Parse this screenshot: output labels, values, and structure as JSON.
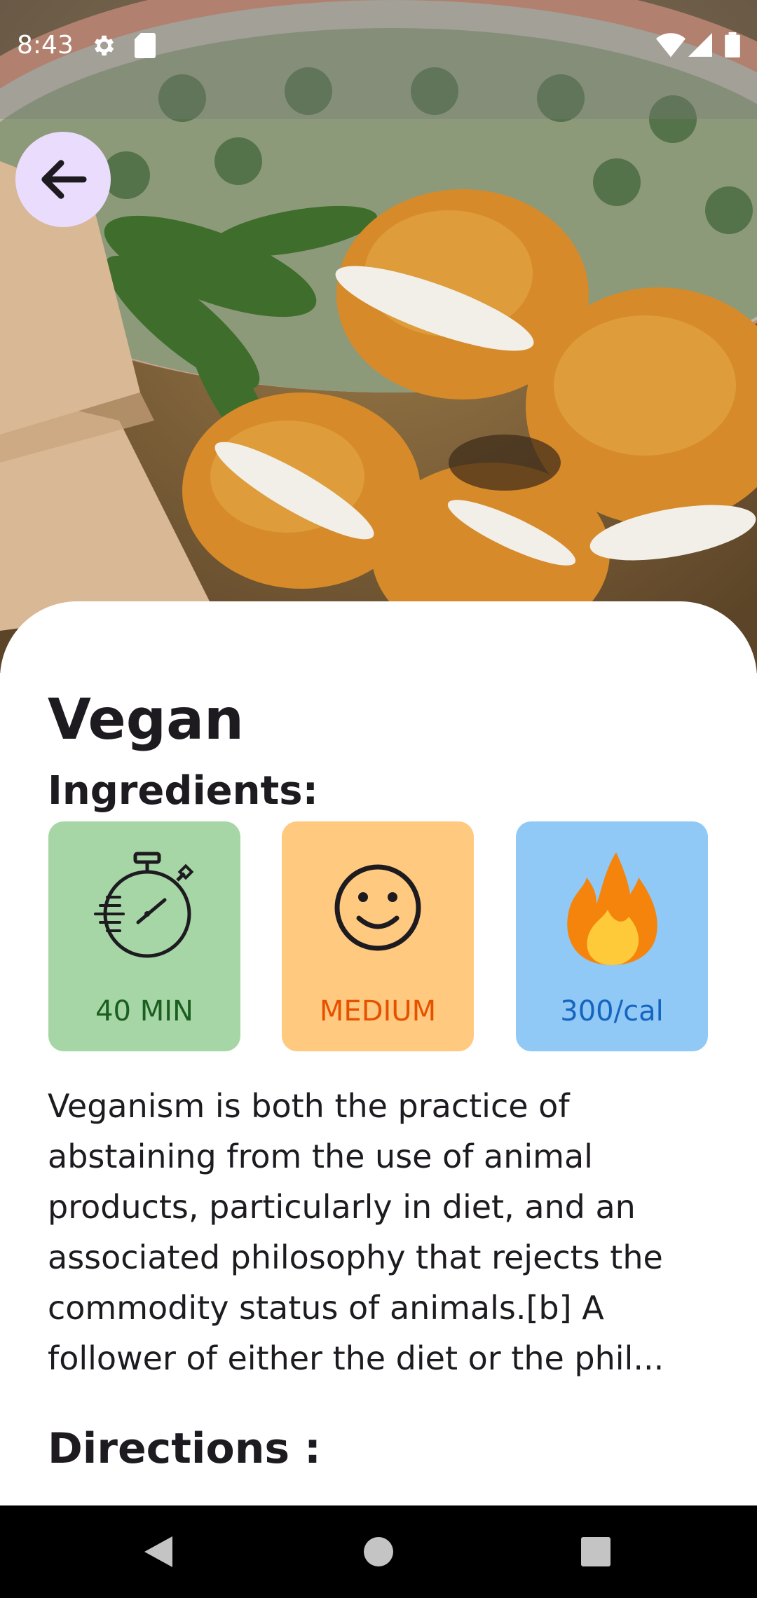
{
  "status_bar": {
    "time": "8:43",
    "icons": [
      "settings-icon",
      "sd-card-icon",
      "wifi-icon",
      "signal-icon",
      "battery-icon"
    ]
  },
  "hero": {
    "image": "food-photo-vegan-falafel-bowl"
  },
  "back_button": {
    "icon": "arrow-back-icon"
  },
  "recipe": {
    "title": "Vegan",
    "ingredients_heading": "Ingredients:",
    "stats": [
      {
        "icon": "stopwatch-icon",
        "label": "40 MIN",
        "color": "#a6d6a5",
        "text_color": "#1b5e20"
      },
      {
        "icon": "smiley-face-icon",
        "label": "MEDIUM",
        "color": "#ffca80",
        "text_color": "#e65100"
      },
      {
        "icon": "fire-icon",
        "label": "300/cal",
        "color": "#90c8f6",
        "text_color": "#1565c0"
      }
    ],
    "description": "Veganism is both the practice of abstaining from the use of animal products, particularly in diet, and an associated philosophy that rejects the commodity status of animals.[b] A follower of either the diet or the phil...",
    "directions_heading": "Directions :"
  },
  "nav_bar": {
    "icons": [
      "back-triangle-icon",
      "home-circle-icon",
      "recents-square-icon"
    ]
  }
}
